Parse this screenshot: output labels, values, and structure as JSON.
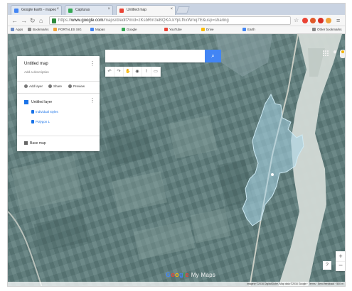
{
  "browser": {
    "tabs": [
      {
        "title": "Google Earth - mapeo",
        "fav_color": "#4285f4",
        "active": false
      },
      {
        "title": "Capturas",
        "fav_color": "#34a853",
        "active": false
      },
      {
        "title": "Untitled map",
        "fav_color": "#ea4335",
        "active": true
      }
    ],
    "url_prefix": "https://",
    "url_domain": "www.google.com",
    "url_rest": "/maps/d/edit?mid=zKsbRm3eBQKA.kYpLfhxWmq7E&usp=sharing",
    "bookmarks": [
      {
        "label": "Apps",
        "color": "#6b8cc7"
      },
      {
        "label": "Bookmarks",
        "color": "#888888"
      },
      {
        "label": "PORTALES SIG",
        "color": "#f0a33b"
      },
      {
        "label": "Mapas",
        "color": "#4285f4"
      },
      {
        "label": "Google",
        "color": "#34a853"
      },
      {
        "label": "YouTube",
        "color": "#ea4335"
      },
      {
        "label": "Drive",
        "color": "#fbbc05"
      },
      {
        "label": "Earth",
        "color": "#4285f4"
      },
      {
        "label": "Other bookmarks",
        "color": "#888888"
      }
    ]
  },
  "panel": {
    "title": "Untitled map",
    "description": "Add a description",
    "actions": [
      "Add layer",
      "Share",
      "Preview"
    ],
    "layer": {
      "name": "Untitled layer",
      "links": [
        "Individual styles",
        "Polygon 1"
      ]
    },
    "base_map_label": "Base map"
  },
  "search": {
    "placeholder": "",
    "button_icon": "search-icon"
  },
  "toolbar": {
    "tools": [
      "↶",
      "↷",
      "✋",
      "◉",
      "⌇",
      "▭"
    ]
  },
  "zoom": {
    "in_label": "+",
    "out_label": "−"
  },
  "help_label": "?",
  "logo": {
    "parts": [
      "G",
      "o",
      "o",
      "g",
      "l",
      "e"
    ],
    "suffix": "My Maps"
  },
  "map": {
    "road_label": "",
    "place_label": "",
    "place_label_2": ""
  },
  "footer": {
    "attribution": "Imagery ©2016 DigitalGlobe, Map data ©2016 Google · Terms · Send feedback · 500 m"
  },
  "colors": {
    "polygon_fill": "#a8d4e6",
    "polygon_stroke": "#cde9f3",
    "river": "#d7ddd8",
    "accent": "#4285f4"
  }
}
